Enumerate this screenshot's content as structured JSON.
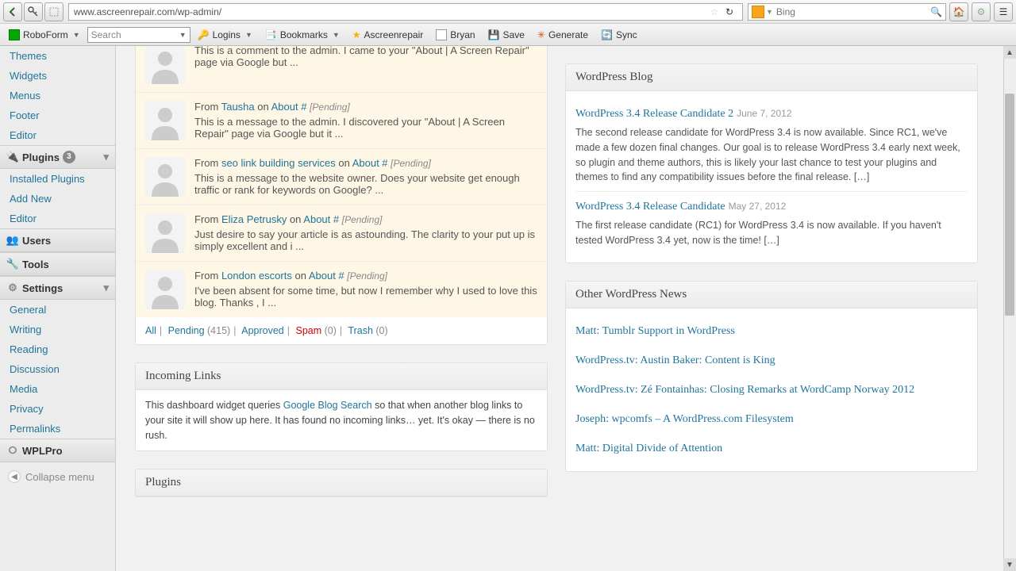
{
  "browser": {
    "url": "www.ascreenrepair.com/wp-admin/",
    "search_placeholder": "Bing"
  },
  "toolbar": {
    "roboform": "RoboForm",
    "search_placeholder": "Search",
    "logins": "Logins",
    "bookmarks": "Bookmarks",
    "ascreen": "Ascreenrepair",
    "bryan": "Bryan",
    "save": "Save",
    "generate": "Generate",
    "sync": "Sync"
  },
  "sidebar": {
    "appearance_sub": [
      "Themes",
      "Widgets",
      "Menus",
      "Footer",
      "Editor"
    ],
    "plugins": {
      "label": "Plugins",
      "count": "3",
      "sub": [
        "Installed Plugins",
        "Add New",
        "Editor"
      ]
    },
    "users": "Users",
    "tools": "Tools",
    "settings": {
      "label": "Settings",
      "sub": [
        "General",
        "Writing",
        "Reading",
        "Discussion",
        "Media",
        "Privacy",
        "Permalinks"
      ]
    },
    "wplpro": "WPLPro",
    "collapse": "Collapse menu"
  },
  "comments": [
    {
      "text": "This is a comment to the admin. I came to your \"About | A Screen Repair\" page via Google but ..."
    },
    {
      "from": "From ",
      "author": "Tausha",
      "on": " on ",
      "target": "About #",
      "pending": "[Pending]",
      "text": "This is a message to the admin. I discovered your \"About | A Screen Repair\" page via Google but it ..."
    },
    {
      "from": "From ",
      "author": "seo link building services",
      "on": " on ",
      "target": "About #",
      "pending": "[Pending]",
      "text": "This is a message to the website owner. Does your website get enough traffic or rank for keywords on Google? ..."
    },
    {
      "from": "From ",
      "author": "Eliza Petrusky",
      "on": " on ",
      "target": "About #",
      "pending": "[Pending]",
      "text": "Just desire to say your article is as astounding. The clarity to your put up is simply excellent and i ..."
    },
    {
      "from": "From ",
      "author": "London escorts",
      "on": " on ",
      "target": "About #",
      "pending": "[Pending]",
      "text": "I've been absent for some time, but now I remember why I used to love this blog. Thanks , I ..."
    }
  ],
  "filter": {
    "all": "All",
    "pending": "Pending",
    "pending_count": "(415)",
    "approved": "Approved",
    "spam": "Spam",
    "spam_count": "(0)",
    "trash": "Trash",
    "trash_count": "(0)"
  },
  "incoming": {
    "title": "Incoming Links",
    "pre": "This dashboard widget queries ",
    "link": "Google Blog Search",
    "post": " so that when another blog links to your site it will show up here. It has found no incoming links… yet. It's okay — there is no rush."
  },
  "plugins_widget": {
    "title": "Plugins"
  },
  "wpblog": {
    "title": "WordPress Blog",
    "items": [
      {
        "title": "WordPress 3.4 Release Candidate 2",
        "date": "June 7, 2012",
        "body": "The second release candidate for WordPress 3.4 is now available. Since RC1, we've made a few dozen final changes. Our goal is to release WordPress 3.4 early next week, so plugin and theme authors, this is likely your last chance to test your plugins and themes to find any compatibility issues before the final release. […]"
      },
      {
        "title": "WordPress 3.4 Release Candidate",
        "date": "May 27, 2012",
        "body": "The first release candidate (RC1) for WordPress 3.4 is now available. If you haven't tested WordPress 3.4 yet, now is the time! […]"
      }
    ]
  },
  "othernews": {
    "title": "Other WordPress News",
    "items": [
      "Matt: Tumblr Support in WordPress",
      "WordPress.tv: Austin Baker: Content is King",
      "WordPress.tv: Zé Fontainhas: Closing Remarks at WordCamp Norway 2012",
      "Joseph: wpcomfs – A WordPress.com Filesystem",
      "Matt: Digital Divide of Attention"
    ]
  }
}
